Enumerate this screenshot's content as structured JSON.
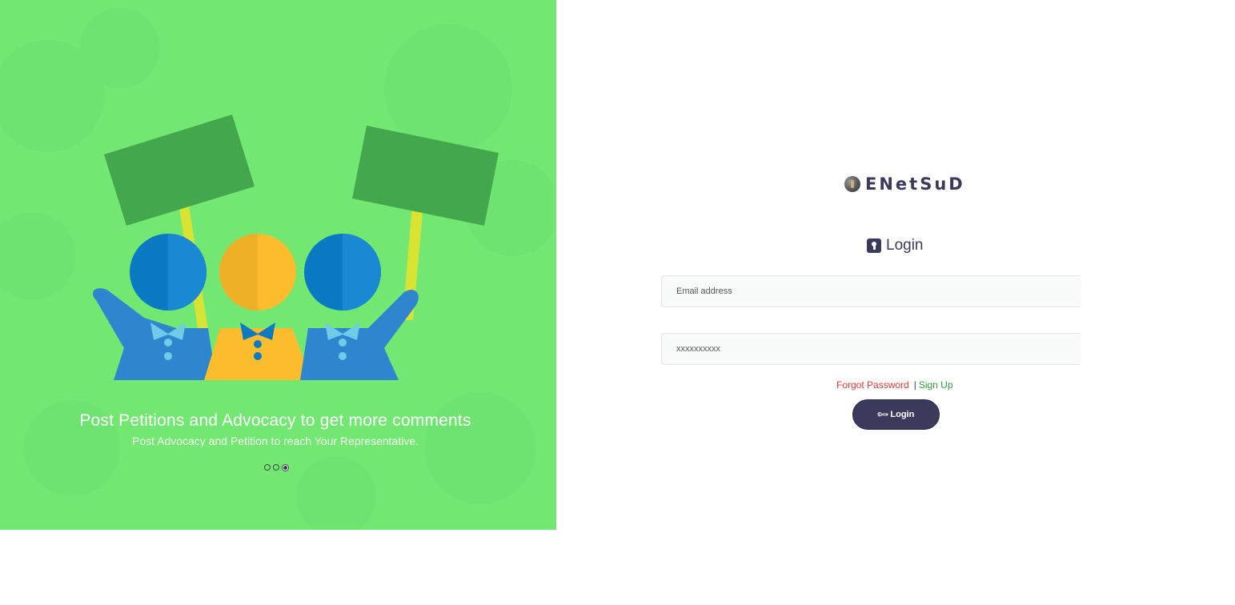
{
  "hero": {
    "title": "Post Petitions and Advocacy to get more comments",
    "subtitle": "Post Advocacy and Petition to reach Your Representative.",
    "slide_count": 3,
    "active_slide": 3,
    "colors": {
      "background": "#72e873",
      "sign": "#43a84d",
      "pole": "#d9e432",
      "blue": "#0a7bc2",
      "yellow": "#fbbd2c",
      "collar": "#6fcbe8"
    }
  },
  "brand": {
    "name": "ENetSuD",
    "logo_icon": "globe-logo-icon"
  },
  "login": {
    "heading": "Login",
    "heading_icon": "keyhole-lock-icon",
    "email_placeholder": "Email address",
    "password_placeholder": "xxxxxxxxxx",
    "forgot_label": "Forgot Password",
    "separator": "|",
    "signup_label": "Sign Up",
    "button_label": "Login",
    "button_icon": "wrench-icon",
    "colors": {
      "primary": "#3b3a5c",
      "forgot": "#e53935",
      "signup": "#2e9e3e"
    }
  }
}
